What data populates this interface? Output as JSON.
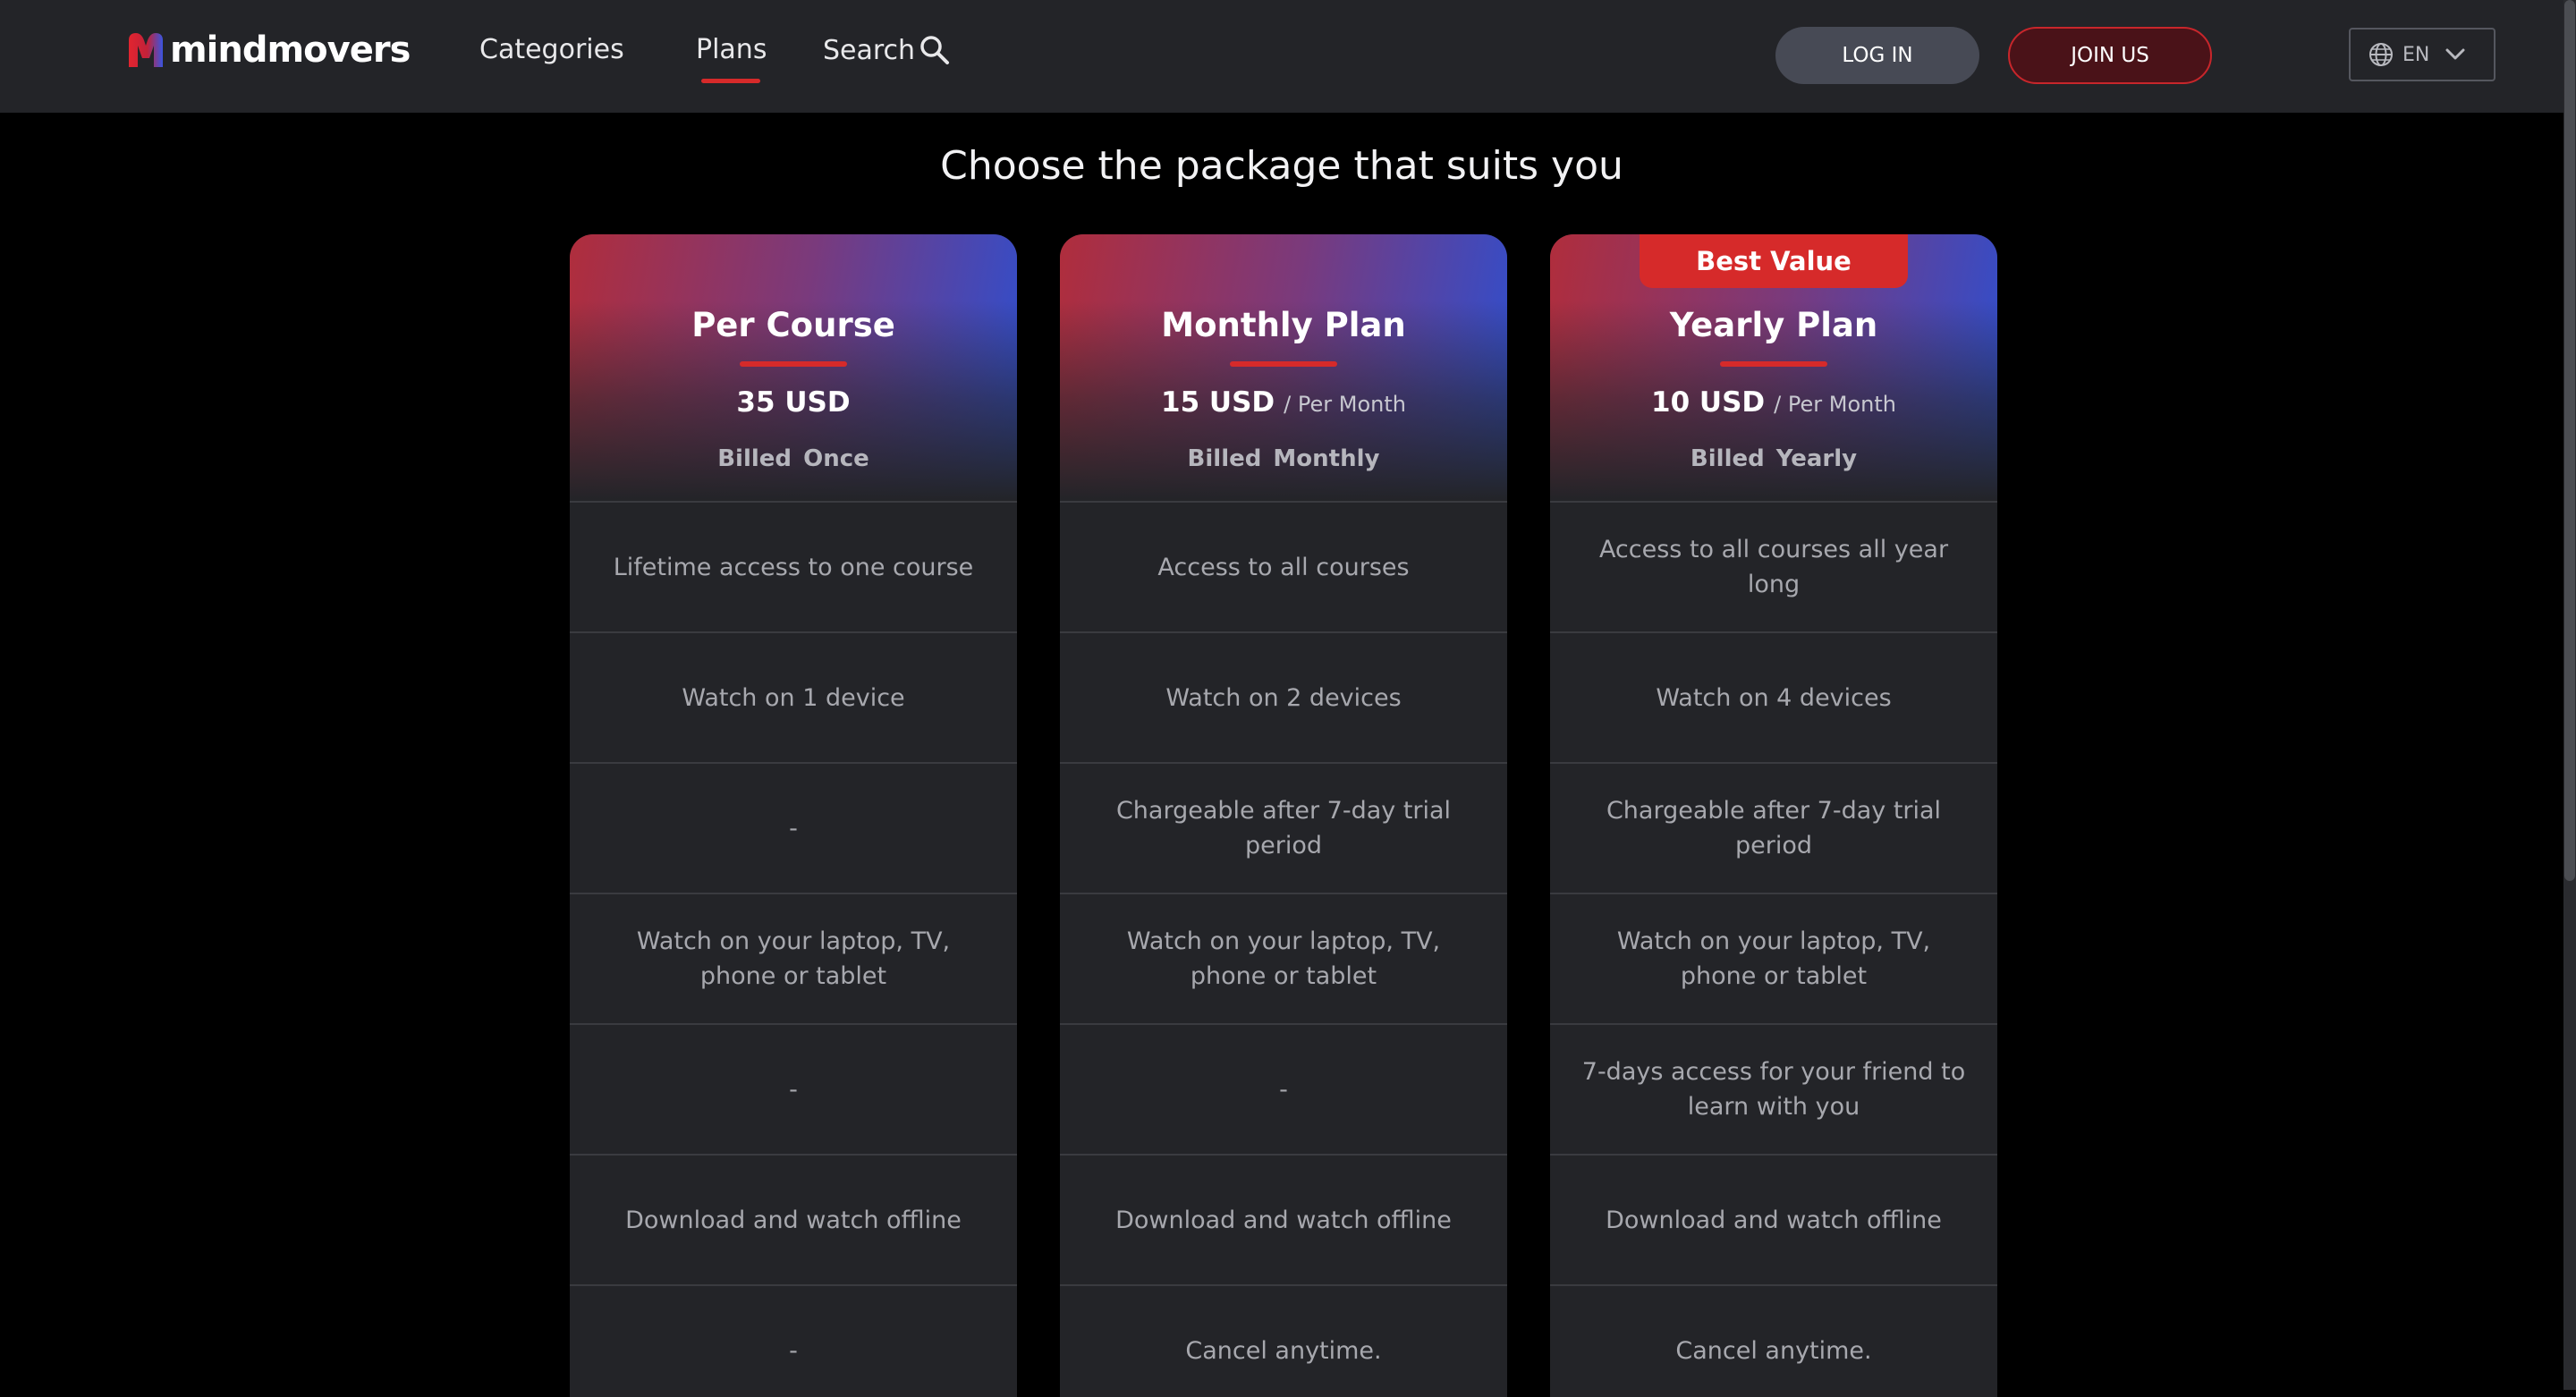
{
  "header": {
    "logo_text": "mindmovers",
    "nav": {
      "categories": "Categories",
      "plans": "Plans",
      "search": "Search"
    },
    "login_label": "LOG IN",
    "join_label": "JOIN US",
    "language": "EN"
  },
  "colors": {
    "accent": "#d62a2a",
    "header_bg": "#232428",
    "page_bg": "#000000",
    "card_bg": "#232428"
  },
  "icons": [
    "logo-mark-icon",
    "search-icon",
    "globe-icon",
    "chevron-down-icon"
  ],
  "page_title": "Choose the package that suits you",
  "plans": [
    {
      "name": "Per Course",
      "price": "35 USD",
      "period": "",
      "billing": "Billed Once",
      "badge": "",
      "features": [
        "Lifetime access to one course",
        "Watch on 1 device",
        "-",
        "Watch on your laptop, TV, phone or tablet",
        "-",
        "Download and watch offline",
        "-"
      ]
    },
    {
      "name": "Monthly Plan",
      "price": "15 USD",
      "period": "/ Per Month",
      "billing": "Billed Monthly",
      "badge": "",
      "features": [
        "Access to all courses",
        "Watch on 2 devices",
        "Chargeable after 7-day trial period",
        "Watch on your laptop, TV, phone or tablet",
        "-",
        "Download and watch offline",
        "Cancel anytime."
      ]
    },
    {
      "name": "Yearly Plan",
      "price": "10 USD",
      "period": "/ Per Month",
      "billing": "Billed Yearly",
      "badge": "Best Value",
      "features": [
        "Access to all courses all year long",
        "Watch on 4 devices",
        "Chargeable after 7-day trial period",
        "Watch on your laptop, TV, phone or tablet",
        "7-days access for your friend to learn with you",
        "Download and watch offline",
        "Cancel anytime."
      ]
    }
  ]
}
